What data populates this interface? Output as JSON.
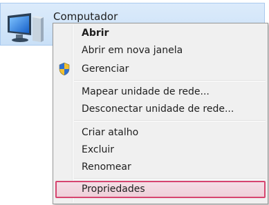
{
  "desktop": {
    "item_label": "Computador"
  },
  "menu": {
    "items": [
      {
        "label": "Abrir"
      },
      {
        "label": "Abrir em nova janela"
      },
      {
        "label": "Gerenciar"
      },
      {
        "label": "Mapear unidade de rede..."
      },
      {
        "label": "Desconectar unidade de rede..."
      },
      {
        "label": "Criar atalho"
      },
      {
        "label": "Excluir"
      },
      {
        "label": "Renomear"
      },
      {
        "label": "Propriedades"
      }
    ]
  },
  "colors": {
    "selection_bg": "#dcebfb",
    "highlight_border": "#d6456f",
    "menu_bg": "#f0f0f0"
  }
}
